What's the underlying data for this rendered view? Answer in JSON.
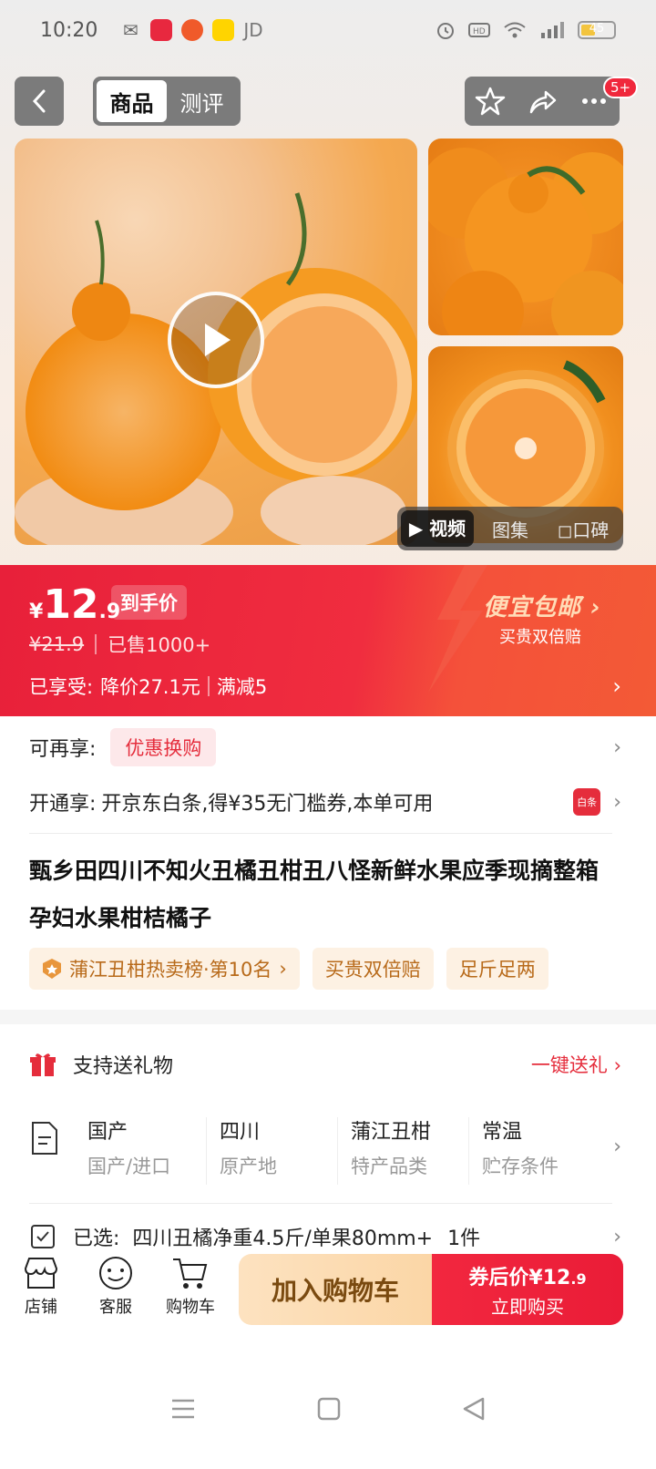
{
  "status_bar": {
    "time": "10:20",
    "carrier_app": "JD",
    "battery": "45",
    "network": "4G"
  },
  "nav": {
    "tabs": [
      "商品",
      "测评"
    ],
    "badge": "5+"
  },
  "media": {
    "tabs": [
      "视频",
      "图集",
      "口碑"
    ]
  },
  "price": {
    "currency": "¥",
    "integer": "12",
    "decimal": ".9",
    "tag": "到手价",
    "original": "¥21.9",
    "sold": "已售1000+",
    "enjoyed_label": "已享受:",
    "enjoyed_discount": "降价27.1元",
    "enjoyed_extra": "满减5",
    "promo_title": "便宜包邮",
    "promo_sub": "买贵双倍赔"
  },
  "offers": {
    "more_label": "可再享:",
    "more_pill": "优惠换购",
    "open_label": "开通享:",
    "open_text": "开京东白条,得¥35无门槛券,本单可用",
    "baitiao_icon_text": "白条"
  },
  "product": {
    "title": "甄乡田四川不知火丑橘丑柑丑八怪新鲜水果应季现摘整箱孕妇水果柑桔橘子",
    "chips": [
      "蒲江丑柑热卖榜·第10名",
      "买贵双倍赔",
      "足斤足两"
    ]
  },
  "gift": {
    "label": "支持送礼物",
    "link": "一键送礼"
  },
  "attributes": [
    {
      "value": "国产",
      "key": "国产/进口"
    },
    {
      "value": "四川",
      "key": "原产地"
    },
    {
      "value": "蒲江丑柑",
      "key": "特产品类"
    },
    {
      "value": "常温",
      "key": "贮存条件"
    }
  ],
  "selected": {
    "label": "已选:",
    "value": "四川丑橘净重4.5斤/单果80mm+",
    "qty": "1件"
  },
  "bottom": {
    "shop": "店铺",
    "service": "客服",
    "cart": "购物车",
    "add_cart": "加入购物车",
    "buy_line1_prefix": "券后价¥12",
    "buy_line1_dec": ".9",
    "buy_line2": "立即购买"
  },
  "colors": {
    "brand_red": "#e8203a",
    "accent_gold": "#ffdcb7"
  }
}
